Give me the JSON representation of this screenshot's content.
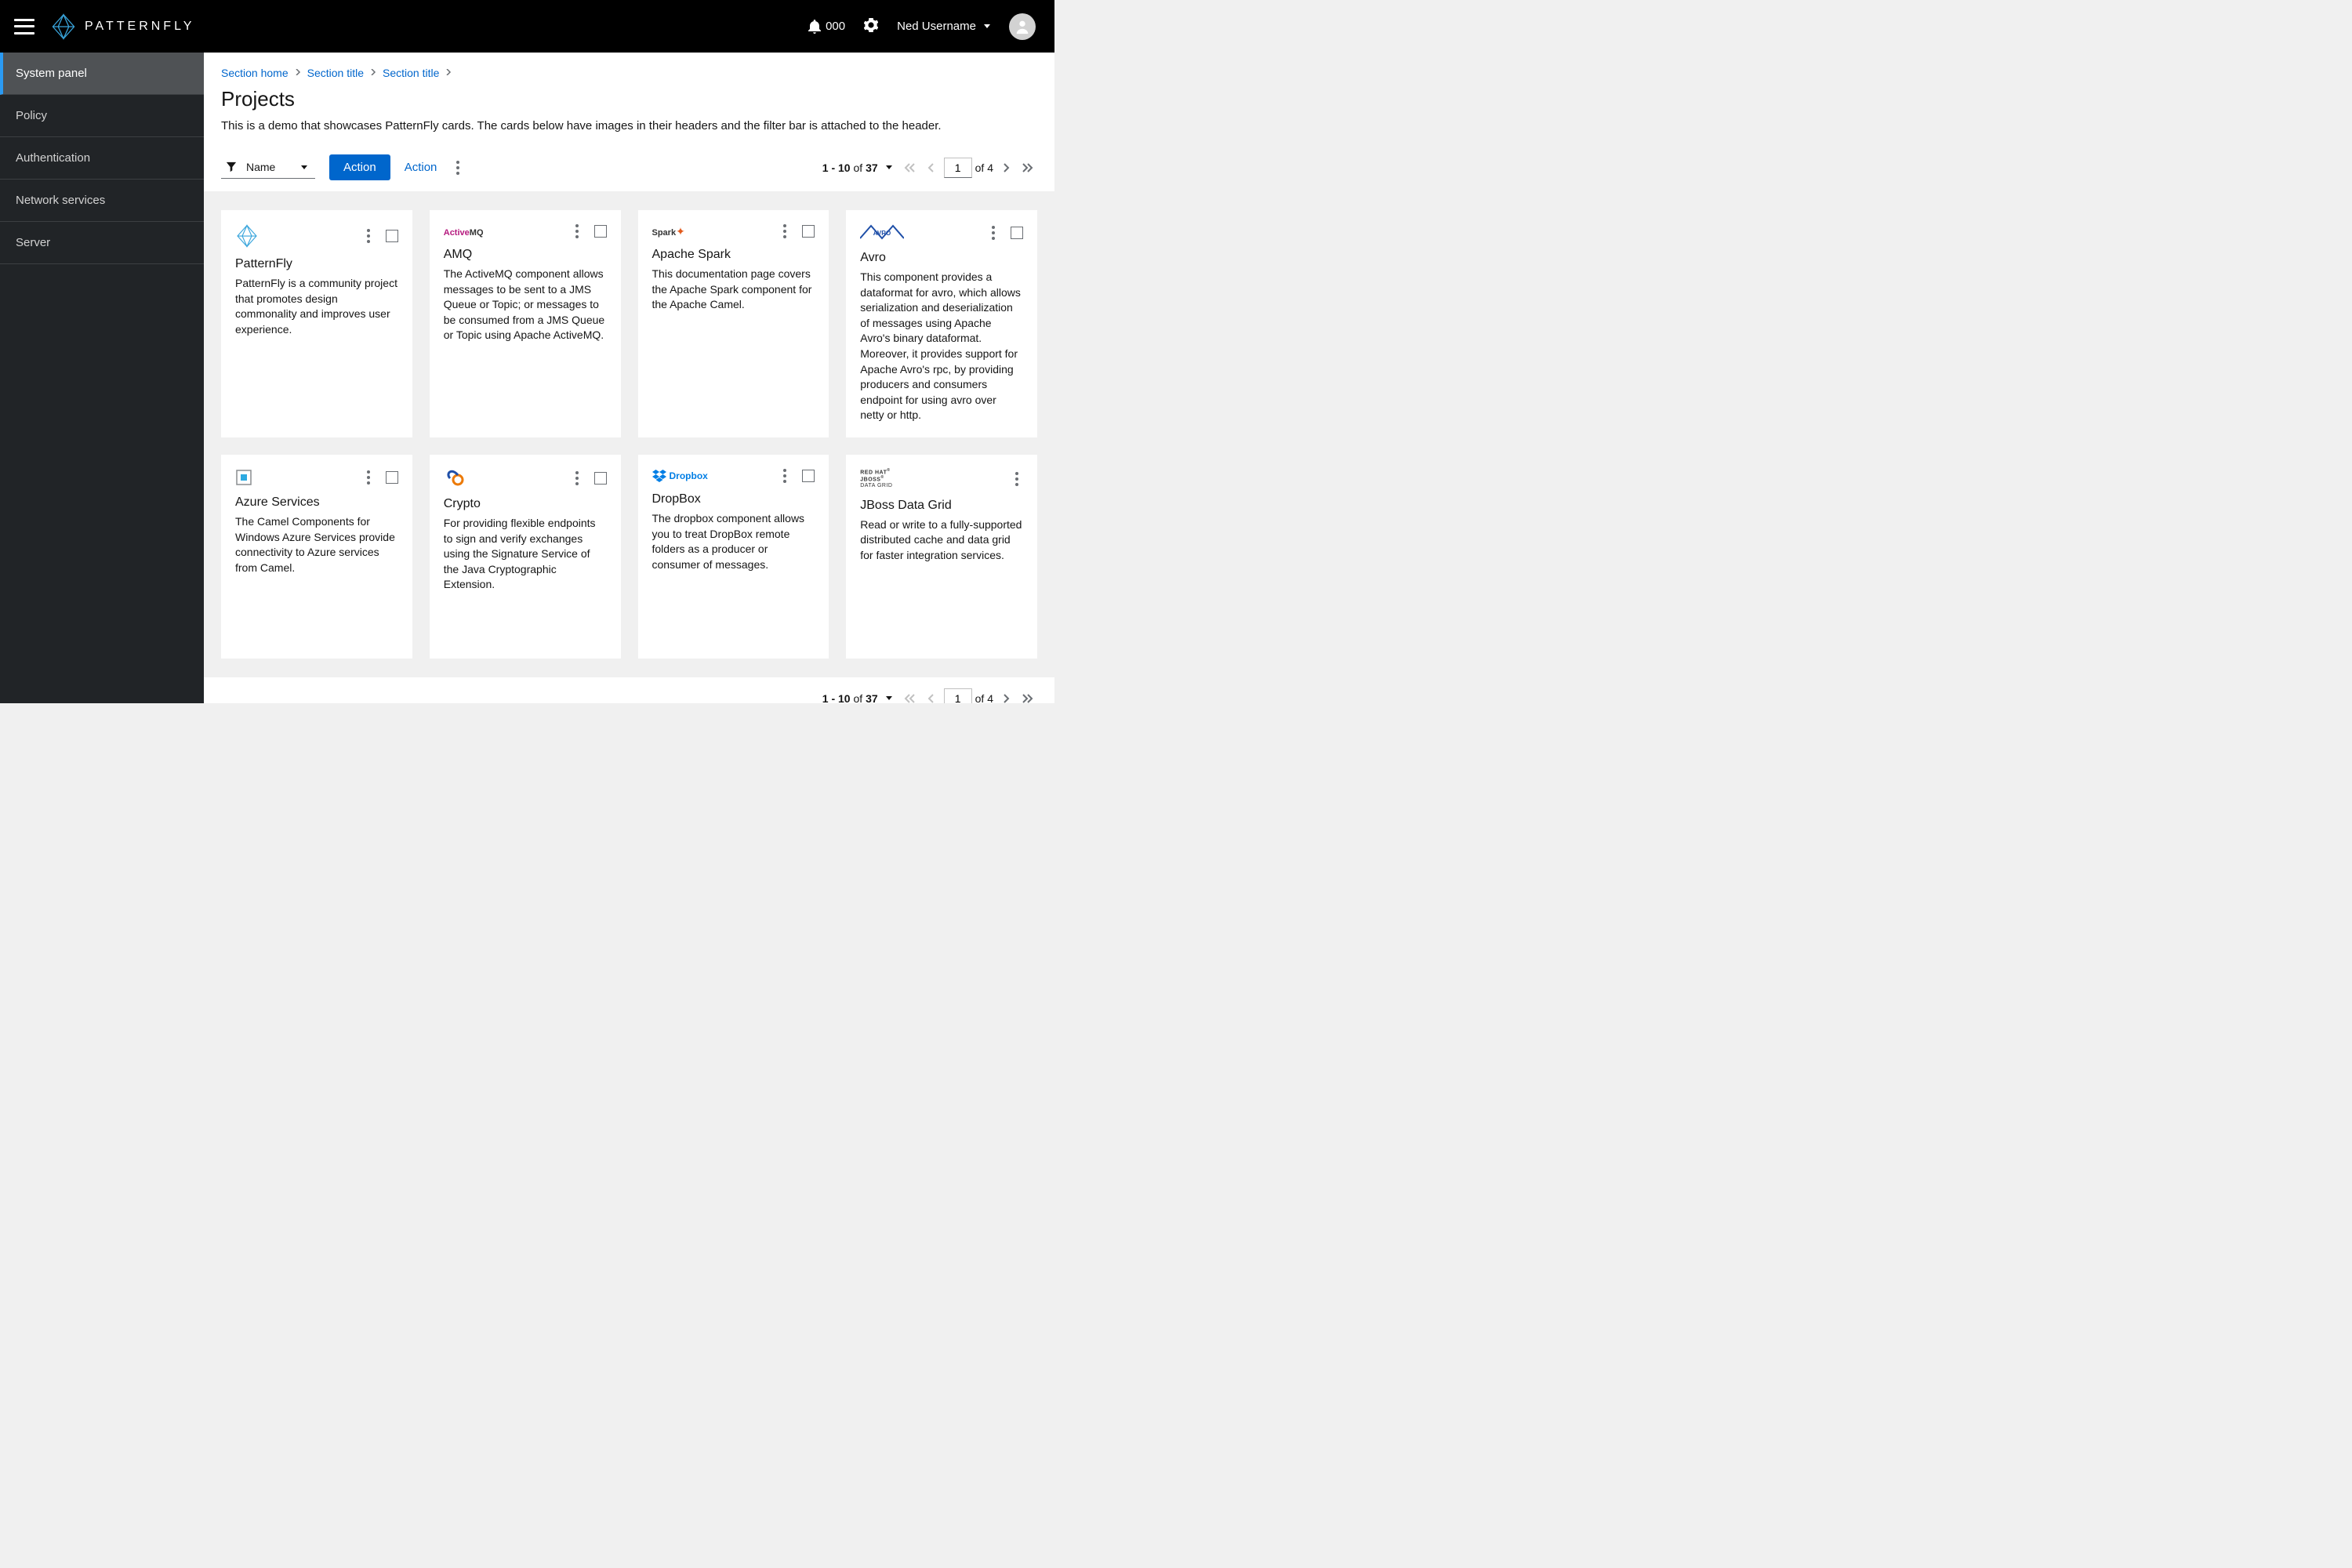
{
  "header": {
    "brand": "PATTERNFLY",
    "notif_count": "000",
    "username": "Ned Username"
  },
  "sidebar": {
    "items": [
      {
        "label": "System panel",
        "active": true
      },
      {
        "label": "Policy",
        "active": false
      },
      {
        "label": "Authentication",
        "active": false
      },
      {
        "label": "Network services",
        "active": false
      },
      {
        "label": "Server",
        "active": false
      }
    ]
  },
  "breadcrumbs": [
    "Section home",
    "Section title",
    "Section title"
  ],
  "page": {
    "title": "Projects",
    "description": "This is a demo that showcases PatternFly cards. The cards below have images in their headers and the filter bar is attached to the header."
  },
  "toolbar": {
    "filter_label": "Name",
    "action_primary": "Action",
    "action_secondary": "Action"
  },
  "pagination": {
    "range": "1 - 10",
    "of_label": "of",
    "total": "37",
    "page_value": "1",
    "page_of": "of 4"
  },
  "cards": [
    {
      "logo": "patternfly",
      "logo_text": "",
      "title": "PatternFly",
      "desc": "PatternFly is a community project that promotes design commonality and improves user experience.",
      "has_checkbox": true
    },
    {
      "logo": "activemq",
      "logo_text": "ActiveMQ",
      "title": "AMQ",
      "desc": "The ActiveMQ component allows messages to be sent to a JMS Queue or Topic; or messages to be consumed from a JMS Queue or Topic using Apache ActiveMQ.",
      "has_checkbox": true
    },
    {
      "logo": "spark",
      "logo_text": "Spark",
      "title": "Apache Spark",
      "desc": "This documentation page covers the Apache Spark component for the Apache Camel.",
      "has_checkbox": true
    },
    {
      "logo": "avro",
      "logo_text": "AVRO",
      "title": "Avro",
      "desc": "This component provides a dataformat for avro, which allows serialization and deserialization of messages using Apache Avro's binary dataformat. Moreover, it provides support for Apache Avro's rpc, by providing producers and consumers endpoint for using avro over netty or http.",
      "has_checkbox": true
    },
    {
      "logo": "azure",
      "logo_text": "",
      "title": "Azure Services",
      "desc": "The Camel Components for Windows Azure Services provide connectivity to Azure services from Camel.",
      "has_checkbox": true
    },
    {
      "logo": "crypto",
      "logo_text": "",
      "title": "Crypto",
      "desc": "For providing flexible endpoints to sign and verify exchanges using the Signature Service of the Java Cryptographic Extension.",
      "has_checkbox": true
    },
    {
      "logo": "dropbox",
      "logo_text": "Dropbox",
      "title": "DropBox",
      "desc": "The dropbox component allows you to treat DropBox remote folders as a producer or consumer of messages.",
      "has_checkbox": true
    },
    {
      "logo": "jboss",
      "logo_text": "RED HAT JBOSS\nDATA GRID",
      "title": "JBoss Data Grid",
      "desc": "Read or write to a fully-supported distributed cache and data grid for faster integration services.",
      "has_checkbox": false
    }
  ]
}
